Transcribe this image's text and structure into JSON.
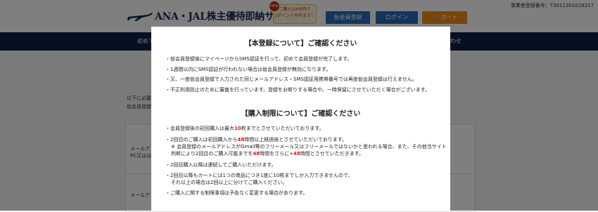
{
  "header": {
    "business_number": "事業者登録番号：T3011301028217",
    "logo_text": "ANA・JAL株主優待即納サービス",
    "promo_badge": "NEW",
    "promo_line1": "ご購入1000円で",
    "promo_line2": "1ポイント付与ます！",
    "register_button": "仮会員登録",
    "login_button": "ログイン",
    "cart_button": "カート"
  },
  "nav": {
    "left_item": "初めて",
    "right_item": "わせ"
  },
  "background": {
    "intro_line1": "以下に必要",
    "intro_line2": "仮会員登録",
    "row1_line1": "メールア",
    "row1_line2": "PC又はは",
    "row2_label": "メールア"
  },
  "modal": {
    "section1_title": "【本登録について】ご確認ください",
    "section1_items": [
      "・仮会員登録後にマイページからSMS認証を行って、初めて会員登録が完了します。",
      "・1週間以内にSMS認証が行われない場合は仮会員登録が無効になります。",
      "・又、一度仮会員登録で入力された同じメールアドレス・SMS認証用携帯番号では再度仮会員登録は行えません。",
      "・不正利用防止のために審査を行っています。登録をお断りする場合や、一時保留にさせていただく場合がございます。"
    ],
    "section2_title": "【購入制限について】ご確認ください",
    "item1_pre": "・会員登録後の初回購入は最大",
    "item1_num": "10",
    "item1_post": "枚までとさせていただいております。",
    "item2_pre": "・2回目のご購入は初回購入から",
    "item2_num": "48",
    "item2_post": "時間以上経過後とさせていただいております。",
    "item2_sub1": "※ 会員登録のメールアドレスがGmail等のフリーメール又はフリーメールではないかと思われる場合、また、その他当サイト",
    "item2_sub2_pre": "判断により2回目のご購入可能までを",
    "item2_sub2_num1": "48",
    "item2_sub2_mid": "時間をさらに+",
    "item2_sub2_num2": "48",
    "item2_sub2_post": "時間とさせていただきます。",
    "item3": "・2回目購入以降は連続してご購入いただけます。",
    "item4_line1": "・2回目以降もカートには1つの商品につき1度に10枚までしか入力できませんので、",
    "item4_line2": "それ以上の場合は2回以上に分けてご購入ください。",
    "item5": "・ご購入に関する制限事項は予告なく変更する場合があります。"
  },
  "colors": {
    "navy": "#0f1e46",
    "button_blue": "#2a68b6",
    "cart_orange": "#f08a16",
    "emphasis_red": "#e0151a"
  }
}
